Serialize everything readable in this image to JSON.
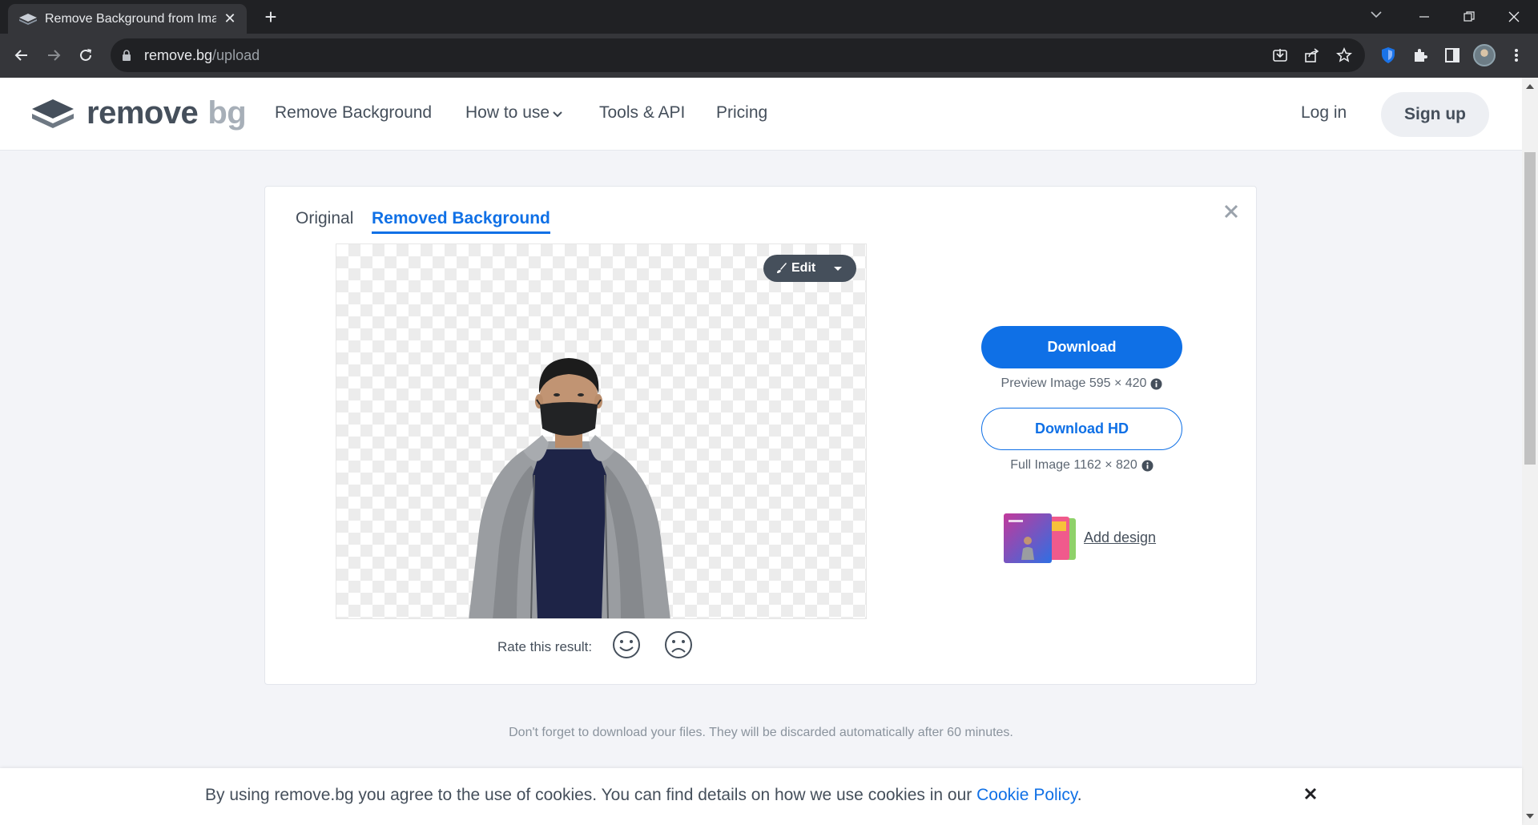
{
  "browser": {
    "tab_title": "Remove Background from Image",
    "tab_close": "✕",
    "new_tab": "+",
    "url_host": "remove.bg",
    "url_path": "/upload"
  },
  "header": {
    "logo_word1": "remove",
    "logo_word2": "bg",
    "nav": [
      {
        "label": "Remove Background"
      },
      {
        "label": "How to use"
      },
      {
        "label": "Tools & API"
      },
      {
        "label": "Pricing"
      }
    ],
    "login": "Log in",
    "signup": "Sign up"
  },
  "result": {
    "tab_original": "Original",
    "tab_removed": "Removed Background",
    "edit_label": "Edit",
    "rate_label": "Rate this result:",
    "download_label": "Download",
    "download_sub": "Preview Image 595 × 420",
    "download_hd_label": "Download HD",
    "download_hd_sub": "Full Image 1162 × 820",
    "add_design": "Add design"
  },
  "note": "Don't forget to download your files. They will be discarded automatically after 60 minutes.",
  "cookie": {
    "text": "By using remove.bg you agree to the use of cookies. You can find details on how we use cookies in our ",
    "link": "Cookie Policy",
    "period": "."
  },
  "colors": {
    "accent": "#0f70e6",
    "text": "#454f5b",
    "chrome_dark": "#202124",
    "chrome_toolbar": "#35363a"
  },
  "icons": [
    "back-arrow-icon",
    "forward-arrow-icon",
    "reload-icon",
    "lock-icon",
    "install-icon",
    "share-icon",
    "star-icon",
    "shield-extension-icon",
    "puzzle-icon",
    "sidepanel-icon",
    "kebab-menu-icon",
    "close-icon",
    "brush-icon",
    "smile-icon",
    "frown-icon",
    "info-icon"
  ]
}
